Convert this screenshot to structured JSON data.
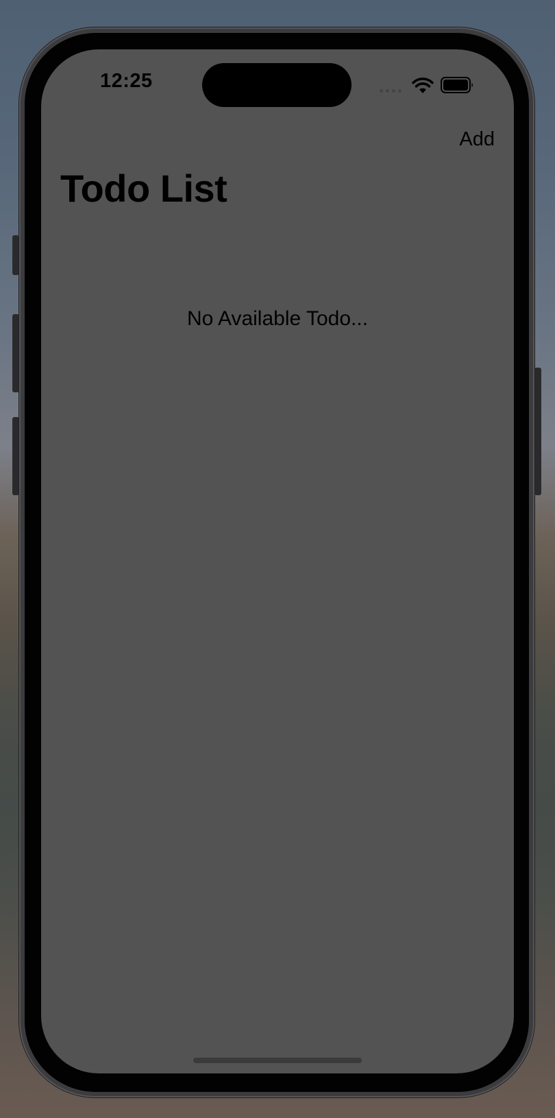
{
  "status_bar": {
    "time": "12:25",
    "signal_icon": "signal-dots-icon",
    "wifi_icon": "wifi-icon",
    "battery_icon": "battery-icon"
  },
  "nav_bar": {
    "add_label": "Add"
  },
  "page": {
    "title": "Todo List",
    "empty_message": "No Available Todo..."
  },
  "colors": {
    "screen_background": "#535353",
    "text": "#000000"
  }
}
